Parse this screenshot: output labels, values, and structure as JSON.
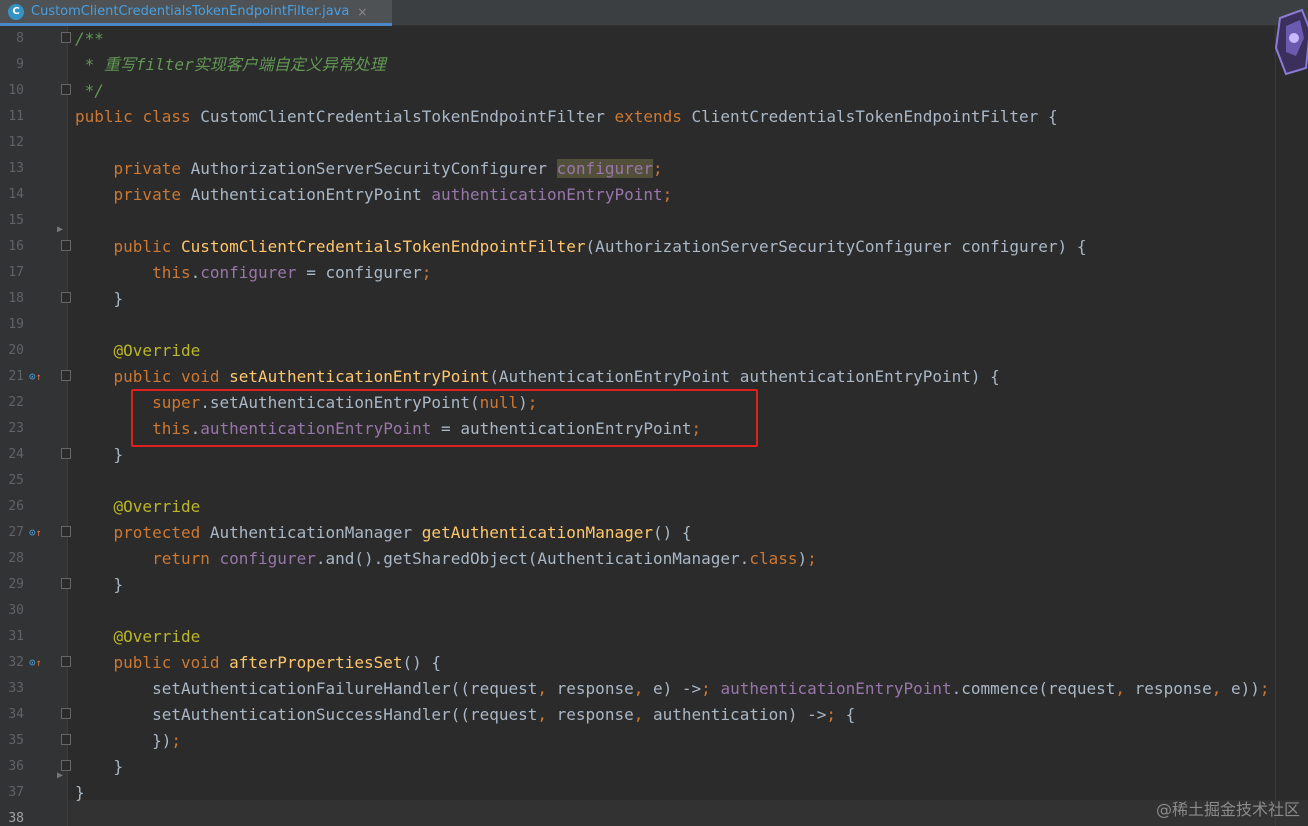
{
  "tab": {
    "icon_letter": "C",
    "title": "CustomClientCredentialsTokenEndpointFilter.java",
    "close": "×"
  },
  "line_numbers": [
    "8",
    "9",
    "10",
    "11",
    "12",
    "13",
    "14",
    "15",
    "16",
    "17",
    "18",
    "19",
    "20",
    "21",
    "22",
    "23",
    "24",
    "25",
    "26",
    "27",
    "28",
    "29",
    "30",
    "31",
    "32",
    "33",
    "34",
    "35",
    "36",
    "37",
    "38"
  ],
  "code_lines": [
    "/**",
    " * 重写filter实现客户端自定义异常处理",
    " */",
    "public class CustomClientCredentialsTokenEndpointFilter extends ClientCredentialsTokenEndpointFilter {",
    "",
    "    private AuthorizationServerSecurityConfigurer configurer;",
    "    private AuthenticationEntryPoint authenticationEntryPoint;",
    "",
    "    public CustomClientCredentialsTokenEndpointFilter(AuthorizationServerSecurityConfigurer configurer) {",
    "        this.configurer = configurer;",
    "    }",
    "",
    "    @Override",
    "    public void setAuthenticationEntryPoint(AuthenticationEntryPoint authenticationEntryPoint) {",
    "        super.setAuthenticationEntryPoint(null);",
    "        this.authenticationEntryPoint = authenticationEntryPoint;",
    "    }",
    "",
    "    @Override",
    "    protected AuthenticationManager getAuthenticationManager() {",
    "        return configurer.and().getSharedObject(AuthenticationManager.class);",
    "    }",
    "",
    "    @Override",
    "    public void afterPropertiesSet() {",
    "        setAuthenticationFailureHandler((request, response, e) -> authenticationEntryPoint.commence(request, response, e));",
    "        setAuthenticationSuccessHandler((request, response, authentication) -> {",
    "        });",
    "    }",
    "}",
    ""
  ],
  "watermark": "@稀土掘金技术社区",
  "colors": {
    "background": "#2b2b2b",
    "keyword": "#cc7832",
    "comment": "#629755",
    "field": "#9876aa",
    "annotation": "#bbb529",
    "method": "#ffc66d",
    "highlight_box": "#e0201e"
  }
}
